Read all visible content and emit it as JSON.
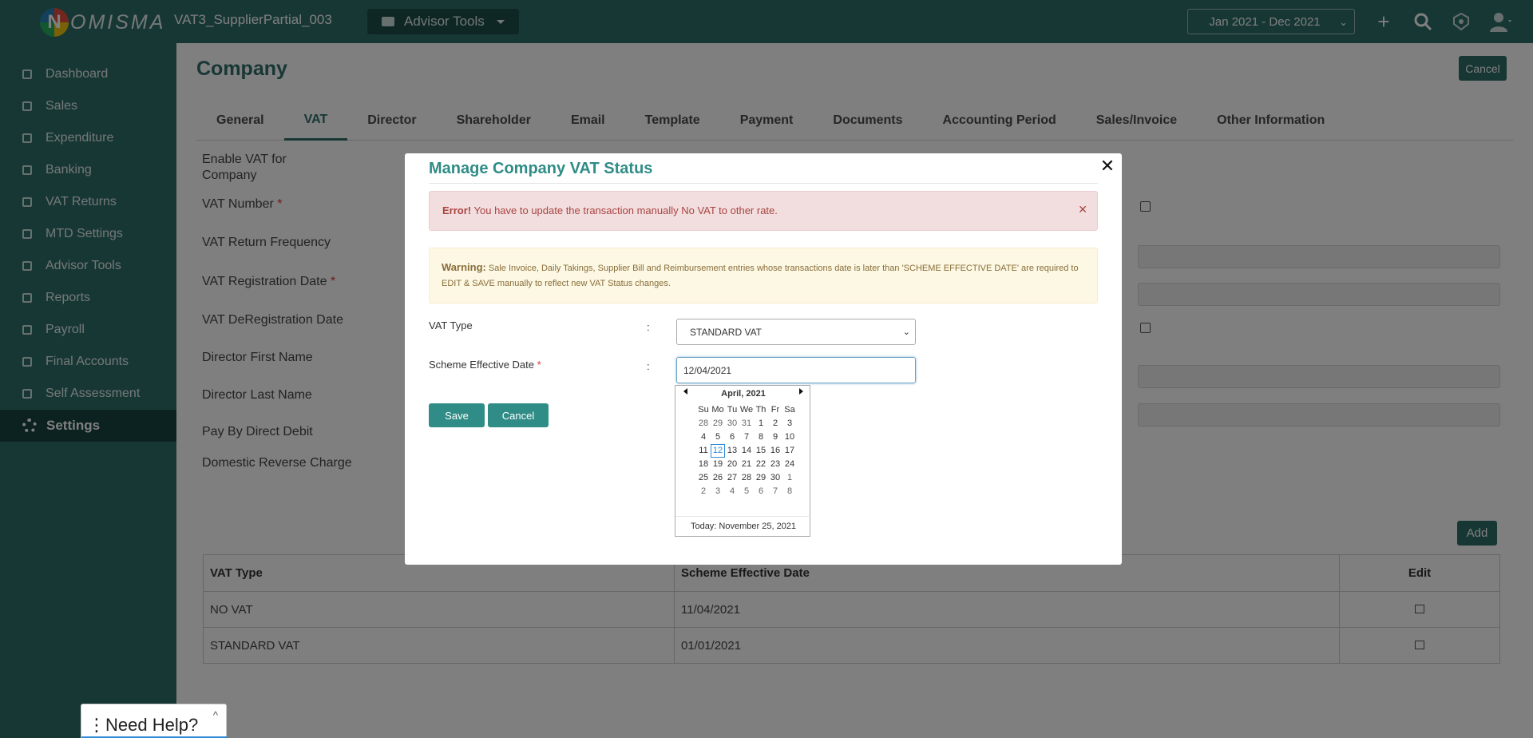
{
  "app": {
    "logo_letter": "N",
    "logo_text": "OMISMA",
    "company_name": "VAT3_SupplierPartial_003",
    "advisor_tools_label": "Advisor Tools",
    "period": "Jan 2021 - Dec 2021"
  },
  "sidebar": {
    "items": [
      {
        "label": "Dashboard"
      },
      {
        "label": "Sales"
      },
      {
        "label": "Expenditure"
      },
      {
        "label": "Banking"
      },
      {
        "label": "VAT Returns"
      },
      {
        "label": "MTD Settings"
      },
      {
        "label": "Advisor Tools"
      },
      {
        "label": "Reports"
      },
      {
        "label": "Payroll"
      },
      {
        "label": "Final Accounts"
      },
      {
        "label": "Self Assessment"
      },
      {
        "label": "Settings"
      }
    ]
  },
  "page": {
    "title": "Company",
    "cancel_label": "Cancel",
    "tabs": [
      "General",
      "VAT",
      "Director",
      "Shareholder",
      "Email",
      "Template",
      "Payment",
      "Documents",
      "Accounting Period",
      "Sales/Invoice",
      "Other Information"
    ],
    "active_tab": "VAT",
    "form": {
      "enable_vat": "Enable VAT for Company",
      "vat_number": "VAT Number",
      "vat_return_frequency": "VAT Return Frequency",
      "vat_registration_date": "VAT Registration Date",
      "vat_deregistration_date": "VAT DeRegistration Date",
      "director_first_name": "Director First Name",
      "director_last_name": "Director Last Name",
      "pay_by_direct_debit": "Pay By Direct Debit",
      "domestic_reverse_charge": "Domestic Reverse Charge",
      "required_mark": "*"
    },
    "add_label": "Add",
    "table": {
      "headers": [
        "VAT Type",
        "Scheme Effective Date",
        "Edit"
      ],
      "rows": [
        [
          "NO VAT",
          "11/04/2021"
        ],
        [
          "STANDARD VAT",
          "01/01/2021"
        ]
      ]
    }
  },
  "modal": {
    "title": "Manage Company VAT Status",
    "error_prefix": "Error!",
    "error_text": "You have to update the transaction manually No VAT to other rate.",
    "warning_prefix": "Warning:",
    "warning_text": "Sale Invoice, Daily Takings, Supplier Bill and Reimbursement entries whose transactions date is later than 'SCHEME EFFECTIVE DATE' are required to EDIT & SAVE manually to reflect new VAT Status changes.",
    "vat_type_label": "VAT Type",
    "vat_type_value": "STANDARD VAT",
    "scheme_date_label": "Scheme Effective Date",
    "scheme_date_value": "12/04/2021",
    "colon": ":",
    "save_label": "Save",
    "cancel_label": "Cancel",
    "calendar": {
      "month": "April, 2021",
      "weekdays": [
        "Su",
        "Mo",
        "Tu",
        "We",
        "Th",
        "Fr",
        "Sa"
      ],
      "days": [
        "28",
        "29",
        "30",
        "31",
        "1",
        "2",
        "3",
        "4",
        "5",
        "6",
        "7",
        "8",
        "9",
        "10",
        "11",
        "12",
        "13",
        "14",
        "15",
        "16",
        "17",
        "18",
        "19",
        "20",
        "21",
        "22",
        "23",
        "24",
        "25",
        "26",
        "27",
        "28",
        "29",
        "30",
        "1",
        "2",
        "3",
        "4",
        "5",
        "6",
        "7",
        "8"
      ],
      "selected_day": "12",
      "today": "Today: November 25, 2021"
    }
  },
  "help": {
    "label": "Need Help?"
  },
  "colors": {
    "brand": "#2f6f6a",
    "accent": "#2f8c86",
    "error_bg": "#f2dede",
    "warning_bg": "#fcf8e3"
  }
}
